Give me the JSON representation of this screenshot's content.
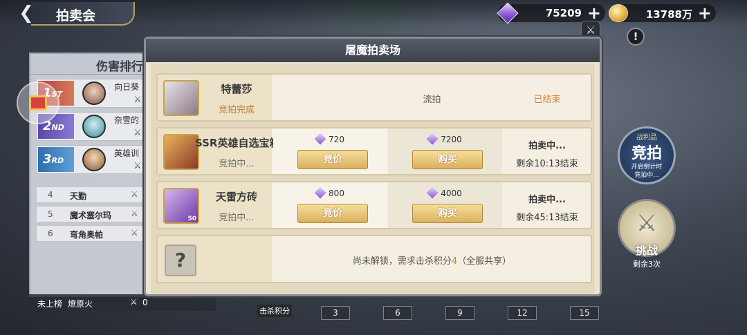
{
  "header": {
    "back_icon": "back-arrow-icon",
    "title": "拍卖会",
    "gems": "75209",
    "gold": "13788万"
  },
  "rank": {
    "title": "伤害排行",
    "top": [
      {
        "medal": "1",
        "suffix": "ST",
        "name": "向日葵"
      },
      {
        "medal": "2",
        "suffix": "ND",
        "name": "奈雪的"
      },
      {
        "medal": "3",
        "suffix": "RD",
        "name": "英雄训"
      }
    ],
    "list": [
      {
        "rank": "4",
        "name": "天勤"
      },
      {
        "rank": "5",
        "name": "魔术塞尔玛"
      },
      {
        "rank": "6",
        "name": "弯角奥帕"
      }
    ],
    "self": {
      "label": "未上榜",
      "name": "燎原火",
      "score": "0"
    }
  },
  "modal": {
    "title": "屠魔拍卖场",
    "items": [
      {
        "name": "特蕾莎",
        "status": "竞拍完成",
        "mid": "流拍",
        "right": "已结束"
      },
      {
        "name": "SSR英雄自选宝箱",
        "status": "竞拍中...",
        "bid_price": "720",
        "bid_label": "竞价",
        "buy_price": "7200",
        "buy_label": "购买",
        "state": "拍卖中...",
        "remaining": "剩余10:13结束"
      },
      {
        "name": "天雷方砖",
        "status": "竞拍中...",
        "badge": "50",
        "bid_price": "800",
        "bid_label": "竞价",
        "buy_price": "4000",
        "buy_label": "购买",
        "state": "拍卖中...",
        "remaining": "剩余45:13结束"
      }
    ],
    "locked": {
      "prefix": "尚未解锁，需求击杀积分",
      "points": "4",
      "suffix": "（全服共享）"
    }
  },
  "side": {
    "auction_top": "战利品",
    "auction_label": "竞拍",
    "auction_line1": "开启倒计时",
    "auction_line2": "竞拍中...",
    "challenge_label": "挑战",
    "challenge_remaining": "剩余3次"
  },
  "progress": {
    "label": "击杀积分",
    "milestones": [
      "3",
      "6",
      "9",
      "12",
      "15"
    ]
  },
  "colors": {
    "accent_orange": "#d0843a",
    "gold_button": "#dcb060",
    "gem_purple": "#8d5bd6"
  }
}
